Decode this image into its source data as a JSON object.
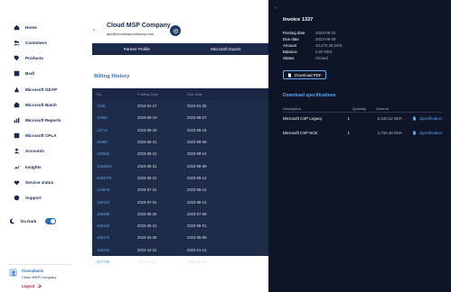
{
  "sidebar": {
    "items": [
      {
        "label": "Home",
        "icon": "home-icon"
      },
      {
        "label": "Customers",
        "icon": "users-icon"
      },
      {
        "label": "Products",
        "icon": "tag-icon"
      },
      {
        "label": "Bsdl",
        "icon": "table-icon"
      },
      {
        "label": "Microsoft GDAP",
        "icon": "gdap-icon"
      },
      {
        "label": "Microsoft Batch",
        "icon": "batch-icon"
      },
      {
        "label": "Microsoft Reports",
        "icon": "report-icon"
      },
      {
        "label": "Microsoft CPLA",
        "icon": "cpla-icon"
      },
      {
        "label": "Accounts",
        "icon": "accounts-icon"
      },
      {
        "label": "Insights",
        "icon": "insights-icon"
      },
      {
        "label": "Service status",
        "icon": "status-icon"
      },
      {
        "label": "Support",
        "icon": "support-icon"
      }
    ],
    "darkmode_label": "Da Dark",
    "user": {
      "name": "Consultants",
      "company": "Cloud MSP Company",
      "logout": "Logout"
    }
  },
  "header": {
    "company": "Cloud MSP Company",
    "email": "kpd@cloudmspcompany.com"
  },
  "tabs": [
    {
      "label": "Partner Profile"
    },
    {
      "label": "Microsoft Export"
    }
  ],
  "billing": {
    "title": "Billing History",
    "columns": [
      "No.",
      "Posting Date",
      "Due Date"
    ],
    "rows": [
      [
        "1246",
        "2024-01-17",
        "2024-01-25"
      ],
      [
        "12555",
        "2023-09-19",
        "2023-09-27"
      ],
      [
        "13713",
        "2023-09-19",
        "2023-09-19"
      ],
      [
        "15465",
        "2023-08-31",
        "2023-09-09"
      ],
      [
        "132555",
        "2023-08-31",
        "2023-09-14"
      ],
      [
        "1434818",
        "2023-08-31",
        "2023-09-09"
      ],
      [
        "5483379",
        "2023-08-31",
        "2023-09-14"
      ],
      [
        "124678",
        "2023-07-31",
        "2023-08-14"
      ],
      [
        "156723",
        "2023-07-31",
        "2023-08-14"
      ],
      [
        "156489",
        "2023-06-30",
        "2023-07-09"
      ],
      [
        "456123",
        "2023-05-31",
        "2023-06-01"
      ],
      [
        "445170",
        "2023-04-30",
        "2023-05-09"
      ],
      [
        "156234",
        "2022-12-31",
        "2023-01-14"
      ],
      [
        "457789",
        "2022-12-31",
        "2023-01-14"
      ]
    ]
  },
  "invoice": {
    "title": "Invoice 1337",
    "fields": [
      {
        "k": "Posting date",
        "v": "2023-08-31"
      },
      {
        "k": "Due date",
        "v": "2023-09-09"
      },
      {
        "k": "Amount",
        "v": "10,472.35 DKK"
      },
      {
        "k": "Balance",
        "v": "0.00 DKK"
      },
      {
        "k": "Status",
        "v": "Closed"
      }
    ],
    "pdf_label": "Download PDF",
    "specs_title": "Download specifications",
    "spec_columns": [
      "Description",
      "Quantity",
      "Amount"
    ],
    "specs": [
      {
        "desc": "Microsoft CSP Legacy",
        "qty": "1",
        "amount": "5,540.22 DKK",
        "link": "Specification"
      },
      {
        "desc": "Microsoft CSP NCE",
        "qty": "1",
        "amount": "2,736.48 DKK",
        "link": "Specification"
      }
    ]
  }
}
